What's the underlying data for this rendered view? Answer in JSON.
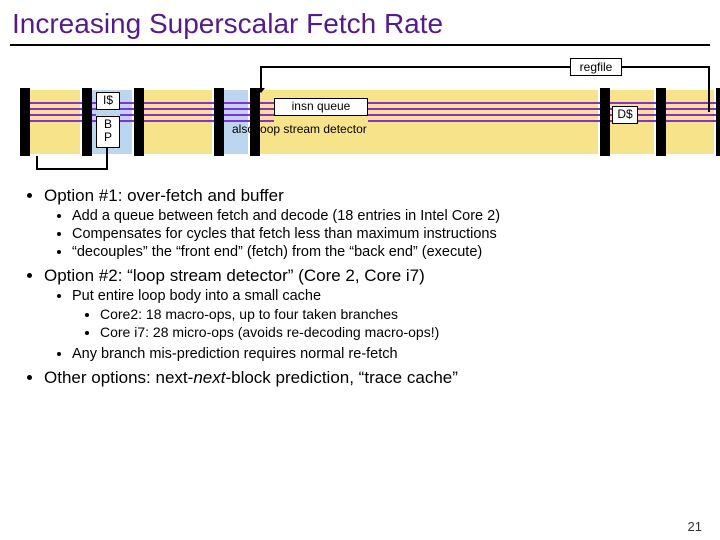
{
  "title": "Increasing Superscalar Fetch Rate",
  "diagram": {
    "regfile": "regfile",
    "icache": "I$",
    "bp_line1": "B",
    "bp_line2": "P",
    "insn_queue": "insn queue",
    "loop_detector": "also loop stream detector",
    "dcache": "D$"
  },
  "bullets": {
    "opt1": "Option #1: over-fetch and buffer",
    "opt1_a": "Add a queue between fetch and decode (18 entries in Intel Core 2)",
    "opt1_b": "Compensates for cycles that fetch less than maximum instructions",
    "opt1_c": "“decouples” the “front end” (fetch) from the “back end” (execute)",
    "opt2": "Option #2: “loop stream detector” (Core 2, Core i7)",
    "opt2_a": "Put entire loop body into a small cache",
    "opt2_a1": "Core2: 18 macro-ops, up to four taken branches",
    "opt2_a2": "Core i7: 28 micro-ops (avoids re-decoding macro-ops!)",
    "opt2_b": "Any branch mis-prediction requires normal re-fetch",
    "opt3_pre": "Other options: next-",
    "opt3_ital": "next",
    "opt3_post": "-block prediction, “trace cache”"
  },
  "page_number": "21"
}
